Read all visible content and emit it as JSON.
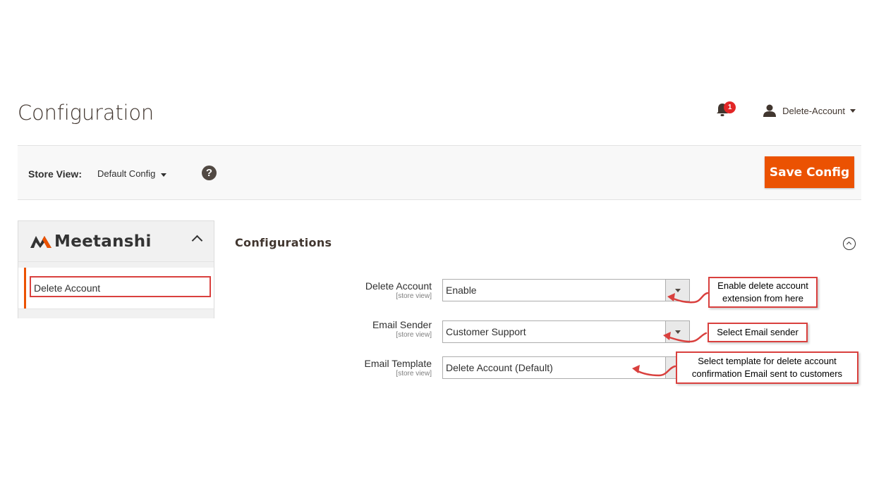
{
  "header": {
    "title": "Configuration",
    "notifications_count": "1",
    "user_name": "Delete-Account"
  },
  "store_bar": {
    "label": "Store View:",
    "selected": "Default Config",
    "help": "?",
    "save_label": "Save Config"
  },
  "sidebar": {
    "brand": "Meetanshi",
    "items": [
      {
        "label": "Delete Account"
      }
    ]
  },
  "section": {
    "title": "Configurations",
    "fields": [
      {
        "label": "Delete Account",
        "scope": "[store view]",
        "value": "Enable"
      },
      {
        "label": "Email Sender",
        "scope": "[store view]",
        "value": "Customer Support"
      },
      {
        "label": "Email Template",
        "scope": "[store view]",
        "value": "Delete Account (Default)"
      }
    ]
  },
  "callouts": [
    {
      "line1": "Enable delete account",
      "line2": "extension from here"
    },
    {
      "line1": "Select Email sender"
    },
    {
      "line1": "Select template for delete account",
      "line2": "confirmation Email sent to customers"
    }
  ],
  "colors": {
    "accent": "#eb5202",
    "callout_border": "#d9403e",
    "badge": "#e22626"
  }
}
